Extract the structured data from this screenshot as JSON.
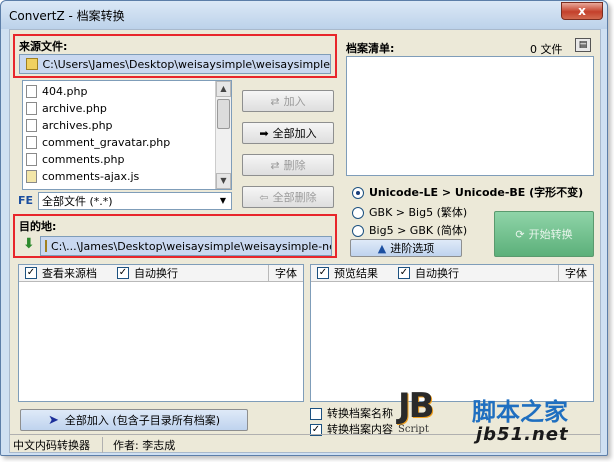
{
  "window": {
    "title": "ConvertZ - 档案转换",
    "close_label": "x"
  },
  "source": {
    "label": "来源文件:",
    "path": "C:\\Users\\James\\Desktop\\weisaysimple\\weisaysimple",
    "files": [
      "404.php",
      "archive.php",
      "archives.php",
      "comment_gravatar.php",
      "comments.php",
      "comments-ajax.js"
    ],
    "filter_badge": "FE",
    "filter_value": "全部文件 (*.*)"
  },
  "actions": {
    "add": "加入",
    "add_all": "全部加入",
    "remove": "删除",
    "remove_all": "全部删除"
  },
  "file_list": {
    "label": "档案清单:",
    "count": "0 文件"
  },
  "conversion": {
    "options": [
      {
        "label": "Unicode-LE > Unicode-BE (字形不变)",
        "selected": true
      },
      {
        "label": "GBK > Big5 (繁体)",
        "selected": false
      },
      {
        "label": "Big5 > GBK (简体)",
        "selected": false
      }
    ],
    "advanced_label": "进阶选项",
    "start_label": "开始转换"
  },
  "destination": {
    "label": "目的地:",
    "path": "C:\\...\\James\\Desktop\\weisaysimple\\weisaysimple-new"
  },
  "source_panel": {
    "view_source": "查看来源档",
    "auto_wrap": "自动换行",
    "font": "字体"
  },
  "preview_panel": {
    "preview": "预览结果",
    "auto_wrap": "自动换行",
    "font": "字体"
  },
  "bottom": {
    "add_all_sub": "全部加入 (包含子目录所有档案)",
    "convert_names": "转换档案名称",
    "convert_contents": "转换档案内容"
  },
  "status": {
    "app_name": "中文内码转换器",
    "author": "作者: 李志成"
  },
  "watermark": {
    "jb": "JB",
    "script": "Script",
    "site_cn": "脚本之家",
    "site_url": "jb51.net"
  },
  "colors": {
    "highlight": "#e8262b",
    "start_button": "#6cc08a",
    "accent_blue": "#1c4fa0"
  }
}
